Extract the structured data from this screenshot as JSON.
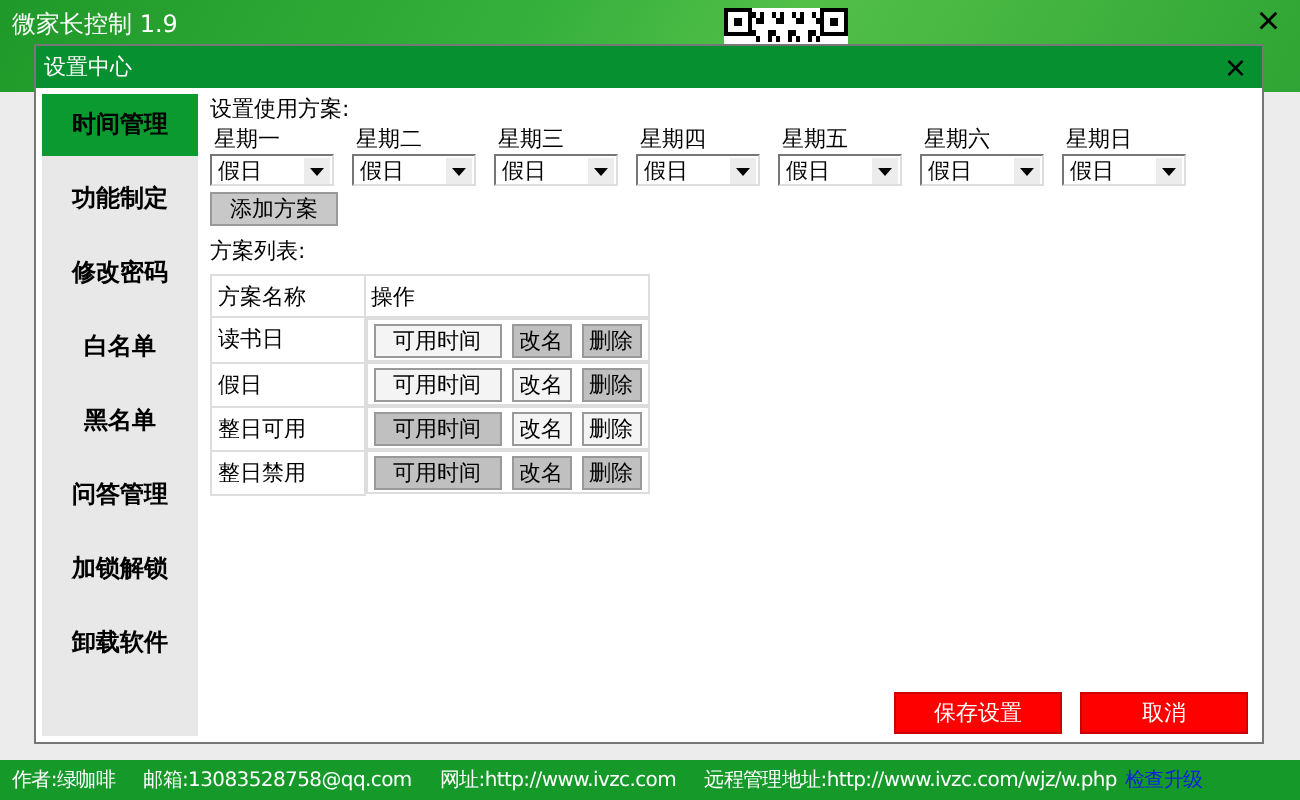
{
  "window": {
    "title": "微家长控制 1.9",
    "close": "×"
  },
  "dialog": {
    "title": "设置中心",
    "close": "×"
  },
  "sidebar": {
    "items": [
      {
        "label": "时间管理",
        "selected": true
      },
      {
        "label": "功能制定",
        "selected": false
      },
      {
        "label": "修改密码",
        "selected": false
      },
      {
        "label": "白名单",
        "selected": false
      },
      {
        "label": "黑名单",
        "selected": false
      },
      {
        "label": "问答管理",
        "selected": false
      },
      {
        "label": "加锁解锁",
        "selected": false
      },
      {
        "label": "卸载软件",
        "selected": false
      }
    ]
  },
  "schedule": {
    "heading": "设置使用方案:",
    "days": [
      {
        "label": "星期一",
        "value": "假日"
      },
      {
        "label": "星期二",
        "value": "假日"
      },
      {
        "label": "星期三",
        "value": "假日"
      },
      {
        "label": "星期四",
        "value": "假日"
      },
      {
        "label": "星期五",
        "value": "假日"
      },
      {
        "label": "星期六",
        "value": "假日"
      },
      {
        "label": "星期日",
        "value": "假日"
      }
    ],
    "add_button": "添加方案"
  },
  "plan_list": {
    "heading": "方案列表:",
    "columns": [
      "方案名称",
      "操作"
    ],
    "rows": [
      {
        "name": "读书日",
        "actions": [
          {
            "label": "可用时间",
            "highlighted": false
          },
          {
            "label": "改名",
            "highlighted": true
          },
          {
            "label": "删除",
            "highlighted": true
          }
        ]
      },
      {
        "name": "假日",
        "actions": [
          {
            "label": "可用时间",
            "highlighted": false
          },
          {
            "label": "改名",
            "highlighted": false
          },
          {
            "label": "删除",
            "highlighted": true
          }
        ]
      },
      {
        "name": "整日可用",
        "actions": [
          {
            "label": "可用时间",
            "highlighted": true
          },
          {
            "label": "改名",
            "highlighted": false
          },
          {
            "label": "删除",
            "highlighted": false
          }
        ]
      },
      {
        "name": "整日禁用",
        "actions": [
          {
            "label": "可用时间",
            "highlighted": true
          },
          {
            "label": "改名",
            "highlighted": true
          },
          {
            "label": "删除",
            "highlighted": true
          }
        ]
      }
    ]
  },
  "buttons": [
    "保存设置",
    "取消"
  ],
  "status_bar": {
    "items": [
      "作者:绿咖啡",
      "邮箱:13083528758@qq.com",
      "网址:http://www.ivzc.com",
      "远程管理地址:http://www.ivzc.com/wjz/w.php"
    ],
    "link": "检查升级"
  }
}
